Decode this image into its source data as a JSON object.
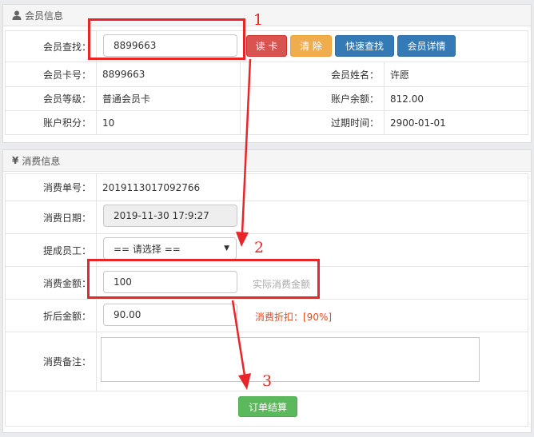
{
  "member": {
    "title": "会员信息",
    "search_label": "会员查找：",
    "search_value": "8899663",
    "buttons": {
      "read": "读 卡",
      "clear": "清 除",
      "quick": "快速查找",
      "detail": "会员详情"
    },
    "card_no_label": "会员卡号：",
    "card_no": "8899663",
    "name_label": "会员姓名：",
    "name": "许愿",
    "level_label": "会员等级：",
    "level": "普通会员卡",
    "balance_label": "账户余额：",
    "balance": "812.00",
    "points_label": "账户积分：",
    "points": "10",
    "expiry_label": "过期时间：",
    "expiry": "2900-01-01"
  },
  "consume": {
    "title": "消费信息",
    "title_icon": "¥",
    "order_no_label": "消费单号：",
    "order_no": "2019113017092766",
    "date_label": "消费日期：",
    "date": "2019-11-30 17:9:27",
    "staff_label": "提成员工：",
    "staff_selected": "== 请选择 ==",
    "amount_label": "消费金额：",
    "amount": "100",
    "amount_hint": "实际消费金额",
    "discounted_label": "折后金额：",
    "discounted": "90.00",
    "discount_rate": "消费折扣：[90%]",
    "note_label": "消费备注：",
    "submit": "订单结算"
  },
  "annotations": {
    "n1": "1",
    "n2": "2",
    "n3": "3"
  },
  "colors": {
    "callout": "#e8262a",
    "red_btn": "#d9534f",
    "orange_btn": "#f0ad4e",
    "blue_btn": "#337ab7",
    "green_btn": "#5cb85c"
  }
}
